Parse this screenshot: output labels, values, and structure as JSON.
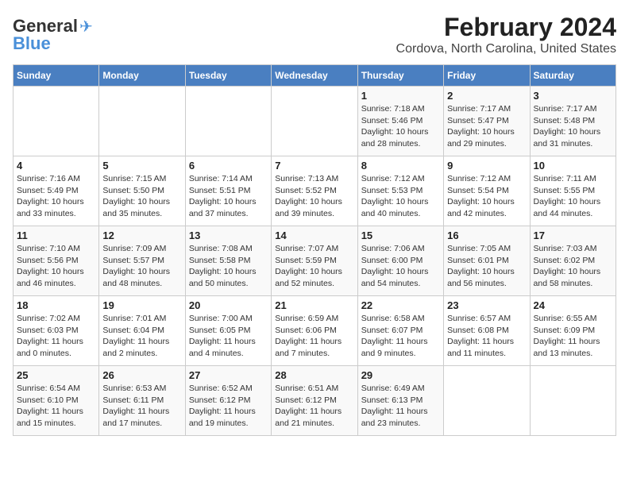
{
  "logo": {
    "line1": "General",
    "line2": "Blue"
  },
  "header": {
    "title": "February 2024",
    "subtitle": "Cordova, North Carolina, United States"
  },
  "weekdays": [
    "Sunday",
    "Monday",
    "Tuesday",
    "Wednesday",
    "Thursday",
    "Friday",
    "Saturday"
  ],
  "weeks": [
    [
      {
        "day": "",
        "info": ""
      },
      {
        "day": "",
        "info": ""
      },
      {
        "day": "",
        "info": ""
      },
      {
        "day": "",
        "info": ""
      },
      {
        "day": "1",
        "info": "Sunrise: 7:18 AM\nSunset: 5:46 PM\nDaylight: 10 hours\nand 28 minutes."
      },
      {
        "day": "2",
        "info": "Sunrise: 7:17 AM\nSunset: 5:47 PM\nDaylight: 10 hours\nand 29 minutes."
      },
      {
        "day": "3",
        "info": "Sunrise: 7:17 AM\nSunset: 5:48 PM\nDaylight: 10 hours\nand 31 minutes."
      }
    ],
    [
      {
        "day": "4",
        "info": "Sunrise: 7:16 AM\nSunset: 5:49 PM\nDaylight: 10 hours\nand 33 minutes."
      },
      {
        "day": "5",
        "info": "Sunrise: 7:15 AM\nSunset: 5:50 PM\nDaylight: 10 hours\nand 35 minutes."
      },
      {
        "day": "6",
        "info": "Sunrise: 7:14 AM\nSunset: 5:51 PM\nDaylight: 10 hours\nand 37 minutes."
      },
      {
        "day": "7",
        "info": "Sunrise: 7:13 AM\nSunset: 5:52 PM\nDaylight: 10 hours\nand 39 minutes."
      },
      {
        "day": "8",
        "info": "Sunrise: 7:12 AM\nSunset: 5:53 PM\nDaylight: 10 hours\nand 40 minutes."
      },
      {
        "day": "9",
        "info": "Sunrise: 7:12 AM\nSunset: 5:54 PM\nDaylight: 10 hours\nand 42 minutes."
      },
      {
        "day": "10",
        "info": "Sunrise: 7:11 AM\nSunset: 5:55 PM\nDaylight: 10 hours\nand 44 minutes."
      }
    ],
    [
      {
        "day": "11",
        "info": "Sunrise: 7:10 AM\nSunset: 5:56 PM\nDaylight: 10 hours\nand 46 minutes."
      },
      {
        "day": "12",
        "info": "Sunrise: 7:09 AM\nSunset: 5:57 PM\nDaylight: 10 hours\nand 48 minutes."
      },
      {
        "day": "13",
        "info": "Sunrise: 7:08 AM\nSunset: 5:58 PM\nDaylight: 10 hours\nand 50 minutes."
      },
      {
        "day": "14",
        "info": "Sunrise: 7:07 AM\nSunset: 5:59 PM\nDaylight: 10 hours\nand 52 minutes."
      },
      {
        "day": "15",
        "info": "Sunrise: 7:06 AM\nSunset: 6:00 PM\nDaylight: 10 hours\nand 54 minutes."
      },
      {
        "day": "16",
        "info": "Sunrise: 7:05 AM\nSunset: 6:01 PM\nDaylight: 10 hours\nand 56 minutes."
      },
      {
        "day": "17",
        "info": "Sunrise: 7:03 AM\nSunset: 6:02 PM\nDaylight: 10 hours\nand 58 minutes."
      }
    ],
    [
      {
        "day": "18",
        "info": "Sunrise: 7:02 AM\nSunset: 6:03 PM\nDaylight: 11 hours\nand 0 minutes."
      },
      {
        "day": "19",
        "info": "Sunrise: 7:01 AM\nSunset: 6:04 PM\nDaylight: 11 hours\nand 2 minutes."
      },
      {
        "day": "20",
        "info": "Sunrise: 7:00 AM\nSunset: 6:05 PM\nDaylight: 11 hours\nand 4 minutes."
      },
      {
        "day": "21",
        "info": "Sunrise: 6:59 AM\nSunset: 6:06 PM\nDaylight: 11 hours\nand 7 minutes."
      },
      {
        "day": "22",
        "info": "Sunrise: 6:58 AM\nSunset: 6:07 PM\nDaylight: 11 hours\nand 9 minutes."
      },
      {
        "day": "23",
        "info": "Sunrise: 6:57 AM\nSunset: 6:08 PM\nDaylight: 11 hours\nand 11 minutes."
      },
      {
        "day": "24",
        "info": "Sunrise: 6:55 AM\nSunset: 6:09 PM\nDaylight: 11 hours\nand 13 minutes."
      }
    ],
    [
      {
        "day": "25",
        "info": "Sunrise: 6:54 AM\nSunset: 6:10 PM\nDaylight: 11 hours\nand 15 minutes."
      },
      {
        "day": "26",
        "info": "Sunrise: 6:53 AM\nSunset: 6:11 PM\nDaylight: 11 hours\nand 17 minutes."
      },
      {
        "day": "27",
        "info": "Sunrise: 6:52 AM\nSunset: 6:12 PM\nDaylight: 11 hours\nand 19 minutes."
      },
      {
        "day": "28",
        "info": "Sunrise: 6:51 AM\nSunset: 6:12 PM\nDaylight: 11 hours\nand 21 minutes."
      },
      {
        "day": "29",
        "info": "Sunrise: 6:49 AM\nSunset: 6:13 PM\nDaylight: 11 hours\nand 23 minutes."
      },
      {
        "day": "",
        "info": ""
      },
      {
        "day": "",
        "info": ""
      }
    ]
  ]
}
